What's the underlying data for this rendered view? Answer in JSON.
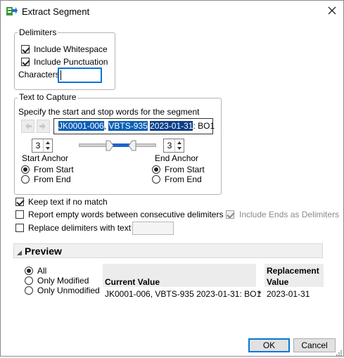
{
  "window": {
    "title": "Extract Segment"
  },
  "delimiters": {
    "legend": "Delimiters",
    "include_whitespace": {
      "label": "Include Whitespace",
      "checked": true
    },
    "include_punctuation": {
      "label": "Include Punctuation",
      "checked": true
    },
    "characters_label": "Characters",
    "characters_value": ""
  },
  "capture": {
    "legend": "Text to Capture",
    "instruction": "Specify the start and stop words for the segment",
    "segments": [
      "JK0001-006",
      ", ",
      "VBTS-935",
      " ",
      "2023-01-31",
      ": ",
      "BO1"
    ],
    "start_anchor": {
      "value": "3",
      "label": "Start Anchor",
      "options": [
        "From Start",
        "From End"
      ],
      "selected": "From Start"
    },
    "end_anchor": {
      "value": "3",
      "label": "End Anchor",
      "options": [
        "From Start",
        "From End"
      ],
      "selected": "From Start"
    }
  },
  "options": {
    "keep_text": {
      "label": "Keep text if no match",
      "checked": true
    },
    "report_empty": {
      "label": "Report empty words between consecutive delimiters",
      "checked": false
    },
    "include_ends": {
      "label": "Include Ends as Delimiters",
      "checked": true
    },
    "replace_delims": {
      "label": "Replace delimiters with text",
      "checked": false,
      "value": ""
    }
  },
  "preview": {
    "title": "Preview",
    "filters": [
      "All",
      "Only Modified",
      "Only Unmodified"
    ],
    "selected_filter": "All",
    "columns": [
      "Current Value",
      "Replacement Value"
    ],
    "rows": [
      {
        "current": "JK0001-006, VBTS-935 2023-01-31: BO1",
        "marker": "*",
        "replacement": "2023-01-31"
      }
    ]
  },
  "buttons": {
    "ok": "OK",
    "cancel": "Cancel"
  }
}
